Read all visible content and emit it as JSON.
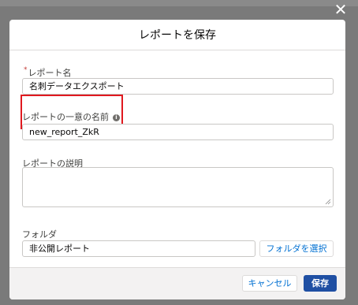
{
  "modal": {
    "title": "レポートを保存",
    "fields": {
      "report_name": {
        "required_mark": "*",
        "label": "レポート名",
        "value": "名刺データエクスポート"
      },
      "unique_name": {
        "label": "レポートの一意の名前",
        "value": "new_report_ZkR",
        "info_icon": "info-icon"
      },
      "description": {
        "label": "レポートの説明",
        "value": ""
      },
      "folder": {
        "label": "フォルダ",
        "value": "非公開レポート",
        "select_button": "フォルダを選択"
      }
    },
    "footer": {
      "cancel_label": "キャンセル",
      "save_label": "保存"
    }
  },
  "colors": {
    "highlight": "#e0191f",
    "brand": "#1f4fa3",
    "link": "#0070d2"
  }
}
